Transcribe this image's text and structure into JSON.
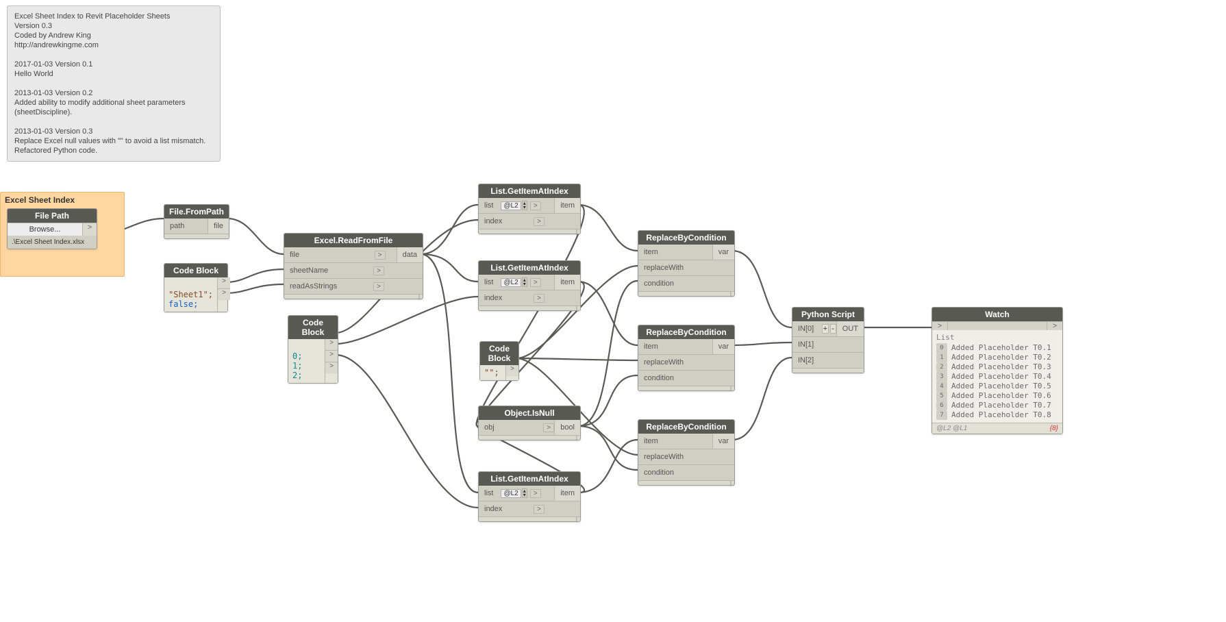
{
  "note": {
    "text": "Excel Sheet Index to Revit Placeholder Sheets\nVersion 0.3\nCoded by Andrew King\nhttp://andrewkingme.com\n\n2017-01-03 Version 0.1\nHello World\n\n2013-01-03 Version 0.2\nAdded ability to modify additional sheet parameters (sheetDiscipline).\n\n2013-01-03 Version 0.3\nReplace Excel null values with \"\" to avoid a list mismatch. Refactored Python code."
  },
  "group": {
    "title": "Excel Sheet Index"
  },
  "filePath": {
    "title": "File Path",
    "browse": "Browse...",
    "path": ".\\Excel Sheet Index.xlsx"
  },
  "fileFromPath": {
    "title": "File.FromPath",
    "in": "path",
    "out": "file"
  },
  "codeBlock1": {
    "title": "Code Block",
    "line1": "\"Sheet1\";",
    "line2": "false;"
  },
  "excelRead": {
    "title": "Excel.ReadFromFile",
    "ins": [
      "file",
      "sheetName",
      "readAsStrings"
    ],
    "out": "data"
  },
  "codeBlock2": {
    "title": "Code Block",
    "line1": "0;",
    "line2": "1;",
    "line3": "2;"
  },
  "listGet": {
    "title": "List.GetItemAtIndex",
    "in1": "list",
    "level": "@L2",
    "in2": "index",
    "out": "item"
  },
  "codeBlock3": {
    "title": "Code Block",
    "line1": "\"\";"
  },
  "objectIsNull": {
    "title": "Object.IsNull",
    "in": "obj",
    "out": "bool"
  },
  "replaceByCondition": {
    "title": "ReplaceByCondition",
    "ins": [
      "item",
      "replaceWith",
      "condition"
    ],
    "out": "var"
  },
  "pythonScript": {
    "title": "Python Script",
    "ins": [
      "IN[0]",
      "IN[1]",
      "IN[2]"
    ],
    "plus": "+",
    "minus": "-",
    "out": "OUT"
  },
  "watch": {
    "title": "Watch",
    "listLabel": "List",
    "items": [
      "Added Placeholder T0.1",
      "Added Placeholder T0.2",
      "Added Placeholder T0.3",
      "Added Placeholder T0.4",
      "Added Placeholder T0.5",
      "Added Placeholder T0.6",
      "Added Placeholder T0.7",
      "Added Placeholder T0.8"
    ],
    "footerLeft": "@L2 @L1",
    "footerRight": "{8}"
  },
  "chevron": ">"
}
